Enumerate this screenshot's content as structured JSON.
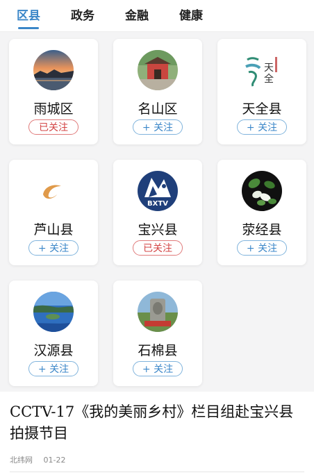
{
  "tabs": [
    {
      "label": "区县",
      "active": true
    },
    {
      "label": "政务",
      "active": false
    },
    {
      "label": "金融",
      "active": false
    },
    {
      "label": "健康",
      "active": false
    }
  ],
  "districts": [
    {
      "name": "雨城区",
      "follow": "已关注",
      "followed": true,
      "icon": "sunset-lake-icon"
    },
    {
      "name": "名山区",
      "follow": "+ 关注",
      "followed": false,
      "icon": "temple-gate-icon"
    },
    {
      "name": "天全县",
      "follow": "+ 关注",
      "followed": false,
      "icon": "calligraphy-logo-icon"
    },
    {
      "name": "芦山县",
      "follow": "+ 关注",
      "followed": false,
      "icon": "orange-swirl-logo-icon"
    },
    {
      "name": "宝兴县",
      "follow": "已关注",
      "followed": true,
      "icon": "bxtv-logo-icon"
    },
    {
      "name": "荥经县",
      "follow": "+ 关注",
      "followed": false,
      "icon": "dove-tree-flower-icon"
    },
    {
      "name": "汉源县",
      "follow": "+ 关注",
      "followed": false,
      "icon": "lake-island-icon"
    },
    {
      "name": "石棉县",
      "follow": "+ 关注",
      "followed": false,
      "icon": "monument-icon"
    }
  ],
  "bxtv_text": "BXTV",
  "news": {
    "title": "CCTV-17《我的美丽乡村》栏目组赴宝兴县拍摄节目",
    "source": "北纬网",
    "date": "01-22"
  },
  "colors": {
    "accent": "#3a86c8",
    "followed": "#d34444"
  }
}
